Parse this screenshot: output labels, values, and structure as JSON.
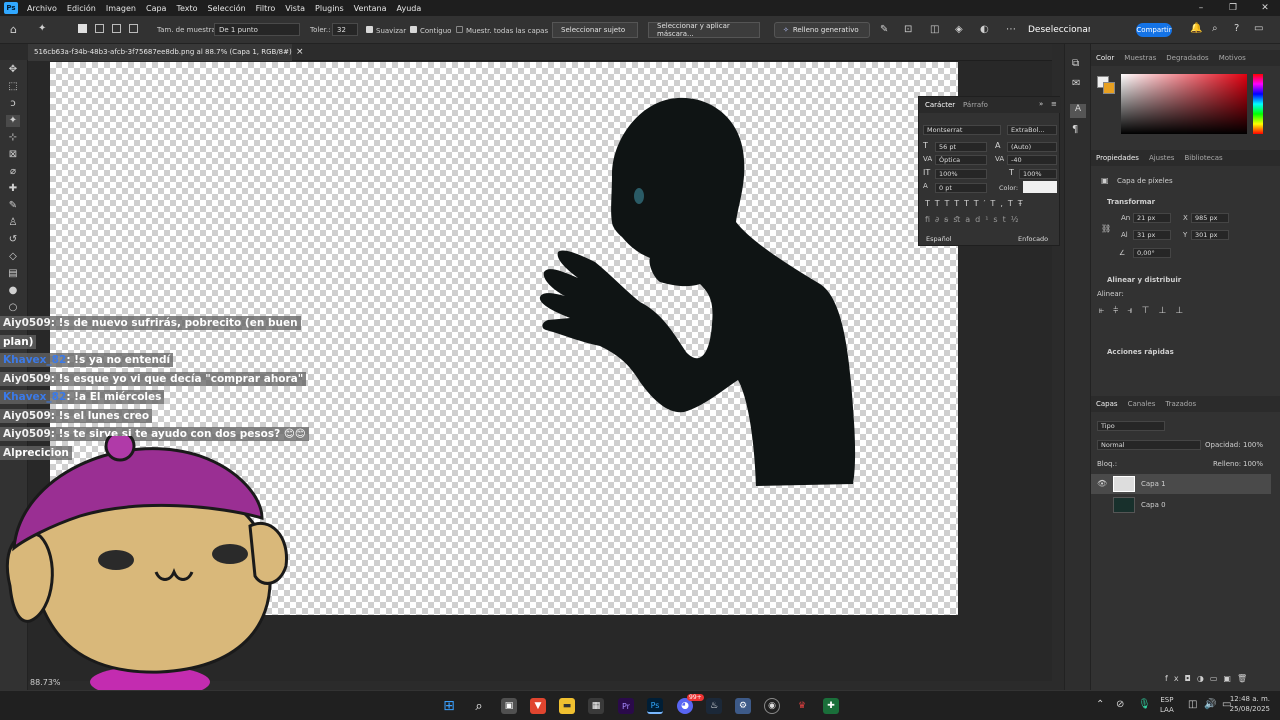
{
  "menu": {
    "app_logo": "Ps",
    "items": [
      "Archivo",
      "Edición",
      "Imagen",
      "Capa",
      "Texto",
      "Selección",
      "Filtro",
      "Vista",
      "Plugins",
      "Ventana",
      "Ayuda"
    ],
    "win_min": "–",
    "win_max": "❐",
    "win_close": "✕"
  },
  "options": {
    "sample_size_label": "Tam. de muestra:",
    "sample_size_value": "De 1 punto",
    "tolerance_label": "Toler.:",
    "tolerance_value": "32",
    "smooth_label": "Suavizar",
    "contiguous_label": "Contiguo",
    "all_layers_label": "Muestr. todas las capas",
    "select_subject": "Seleccionar sujeto",
    "select_mask": "Seleccionar y aplicar máscara...",
    "gen_fill": "Relleno generativo",
    "deselect": "Deseleccionar",
    "share": "Compartir"
  },
  "document": {
    "tab_title": "516cb63a-f34b-48b3-afcb-3f75687ee8db.png al 88.7% (Capa 1, RGB/8#) *",
    "tab_close": "×",
    "zoom": "88.73%"
  },
  "character": {
    "tab_active": "Carácter",
    "tab_other": "Párrafo",
    "font_family": "Montserrat",
    "font_style": "ExtraBol...",
    "size": "56 pt",
    "leading": "(Auto)",
    "kerning": "Óptica",
    "tracking": "-40",
    "vscale": "100%",
    "hscale": "100%",
    "baseline": "0 pt",
    "color_label": "Color:",
    "language": "Español",
    "antialias": "Enfocado"
  },
  "color_panel": {
    "tabs": [
      "Color",
      "Muestras",
      "Degradados",
      "Motivos"
    ]
  },
  "properties": {
    "tabs": [
      "Propiedades",
      "Ajustes",
      "Bibliotecas"
    ],
    "layer_type": "Capa de píxeles",
    "transform_title": "Transformar",
    "w_label": "An",
    "w": "21 px",
    "x_label": "X",
    "x": "985 px",
    "h_label": "Al",
    "h": "31 px",
    "y_label": "Y",
    "y": "301 px",
    "angle": "0,00°",
    "align_title": "Alinear y distribuir",
    "align_label": "Alinear:",
    "quick_title": "Acciones rápidas"
  },
  "layers": {
    "tabs": [
      "Capas",
      "Canales",
      "Trazados"
    ],
    "filter": "Tipo",
    "blend": "Normal",
    "opacity_label": "Opacidad:",
    "opacity": "100%",
    "lock_label": "Bloq.:",
    "fill_label": "Relleno:",
    "fill": "100%",
    "items": [
      "Capa 1",
      "Capa 0"
    ]
  },
  "chat": [
    {
      "user": "Aiy0509",
      "msg": ": !s de nuevo sufrirás, pobrecito (en buen",
      "style": "u1"
    },
    {
      "user": "",
      "msg": "plan)",
      "style": "u1"
    },
    {
      "user": "Khavex_82",
      "msg": ": !s ya no entendí",
      "style": "u2"
    },
    {
      "user": "Aiy0509",
      "msg": ": !s esque yo vi que decía \"comprar ahora\"",
      "style": "u1"
    },
    {
      "user": "Khavex_82",
      "msg": ": !a El miércoles",
      "style": "u2"
    },
    {
      "user": "Aiy0509",
      "msg": ": !s el lunes creo",
      "style": "u1"
    },
    {
      "user": "Aiy0509",
      "msg": ": !s te sirve si te ayudo con dos pesos? 😊😊",
      "style": "u1"
    },
    {
      "user": "Al",
      "msg": "precicion",
      "style": "u1"
    }
  ],
  "taskbar": {
    "lang": "ESP",
    "region": "LAA",
    "time": "12:48 a. m.",
    "date": "25/08/2025",
    "discord_badge": "99+"
  },
  "colors": {
    "accent": "#1473e6",
    "ps_blue": "#31a8ff",
    "silhouette": "#0f1414"
  }
}
